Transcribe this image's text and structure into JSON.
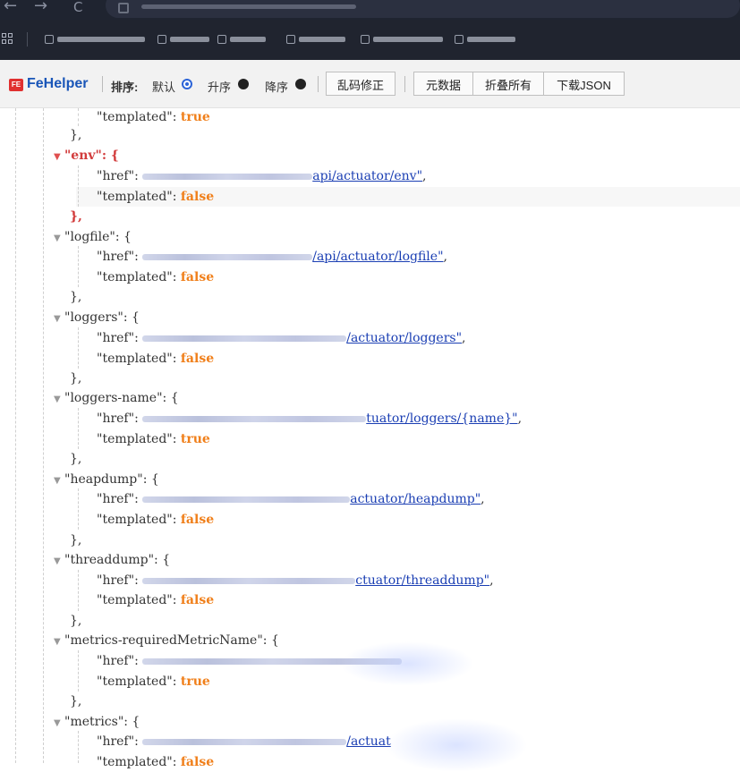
{
  "browser": {
    "nav_back": "←",
    "nav_forward": "→",
    "nav_reload": "C"
  },
  "toolbar": {
    "logo_mark": "FE",
    "app_name": "FeHelper",
    "sort_label": "排序:",
    "sort_options": [
      "默认",
      "升序",
      "降序"
    ],
    "sort_selected": "默认",
    "fix_encoding_button": "乱码修正",
    "metadata_button": "元数据",
    "collapse_all_button": "折叠所有",
    "download_button": "下载JSON"
  },
  "json": {
    "expand_icon": "▼",
    "top_fragment": {
      "key": "\"templated\"",
      "value": "true"
    },
    "entries": [
      {
        "key": "\"env\"",
        "href_suffix": "api/actuator/env\"",
        "templated": "false",
        "trailing": ","
      },
      {
        "key": "\"logfile\"",
        "href_suffix": "/api/actuator/logfile\"",
        "templated": "false",
        "trailing": ","
      },
      {
        "key": "\"loggers\"",
        "href_suffix": "/actuator/loggers\"",
        "templated": "false",
        "trailing": ","
      },
      {
        "key": "\"loggers-name\"",
        "href_suffix": "tuator/loggers/{name}\"",
        "templated": "true",
        "trailing": ","
      },
      {
        "key": "\"heapdump\"",
        "href_suffix": "actuator/heapdump\"",
        "templated": "false",
        "trailing": ","
      },
      {
        "key": "\"threaddump\"",
        "href_suffix": "ctuator/threaddump\"",
        "templated": "false",
        "trailing": ","
      },
      {
        "key": "\"metrics-requiredMetricName\"",
        "href_suffix": "",
        "templated": "true",
        "trailing": ","
      },
      {
        "key": "\"metrics\"",
        "href_suffix": "/actuat",
        "templated": "false",
        "trailing": ""
      }
    ],
    "href_key": "\"href\"",
    "templated_key": "\"templated\"",
    "open_brace": ": {",
    "close_brace": "},",
    "colon": ":",
    "comma": ","
  },
  "colors": {
    "link": "#1a3eb3",
    "value_bool": "#f07f1a",
    "selected_key": "#d23c3c",
    "brand": "#1a56b8"
  }
}
